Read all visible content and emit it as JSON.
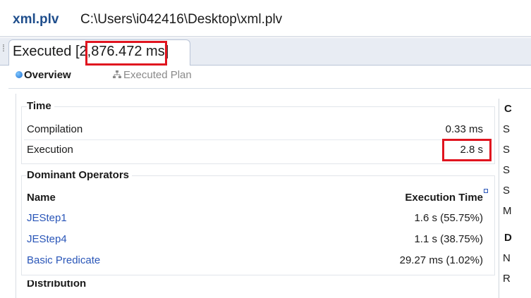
{
  "window": {
    "file_name": "xml.plv",
    "file_path": "C:\\Users\\i042416\\Desktop\\xml.plv"
  },
  "tab": {
    "label": "Executed",
    "duration": "[2,876.472 ms]"
  },
  "subtabs": [
    {
      "label": "Overview",
      "active": true
    },
    {
      "label": "Executed Plan",
      "active": false
    }
  ],
  "time": {
    "title": "Time",
    "rows": [
      {
        "label": "Compilation",
        "value": "0.33 ms"
      },
      {
        "label": "Execution",
        "value": "2.8 s"
      }
    ]
  },
  "dominant_operators": {
    "title": "Dominant Operators",
    "col_name": "Name",
    "col_time": "Execution Time",
    "rows": [
      {
        "name": "JEStep1",
        "time": "1.6 s (55.75%)"
      },
      {
        "name": "JEStep4",
        "time": "1.1 s (38.75%)"
      },
      {
        "name": "Basic Predicate",
        "time": "29.27 ms (1.02%)"
      }
    ]
  },
  "distribution": {
    "title": "Distribution"
  },
  "side_letters": [
    "C",
    "S",
    "S",
    "S",
    "S",
    "M",
    "D",
    "N",
    "R"
  ],
  "colors": {
    "highlight": "#e0141f",
    "link": "#2a56b8",
    "file_name": "#1f4e8c"
  }
}
